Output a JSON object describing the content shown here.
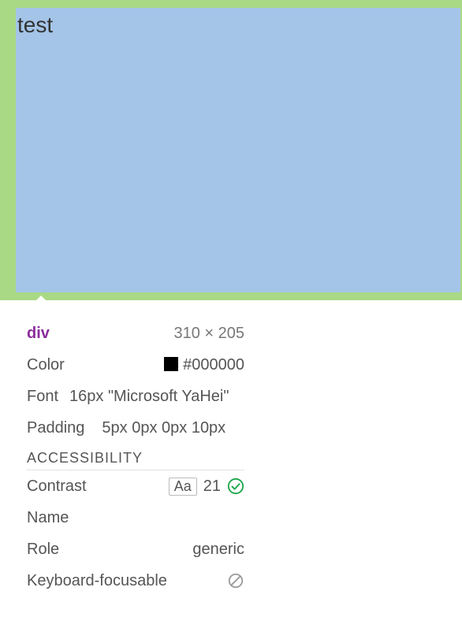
{
  "highlight": {
    "text": "test"
  },
  "tooltip": {
    "tag": "div",
    "dimensions": "310 × 205",
    "color_label": "Color",
    "color_value": "#000000",
    "font_label": "Font",
    "font_value": "16px \"Microsoft YaHei\"",
    "padding_label": "Padding",
    "padding_value": "5px 0px 0px 10px",
    "accessibility_title": "ACCESSIBILITY",
    "contrast_label": "Contrast",
    "contrast_aa": "Aa",
    "contrast_value": "21",
    "name_label": "Name",
    "name_value": "",
    "role_label": "Role",
    "role_value": "generic",
    "keyboard_label": "Keyboard-focusable"
  }
}
